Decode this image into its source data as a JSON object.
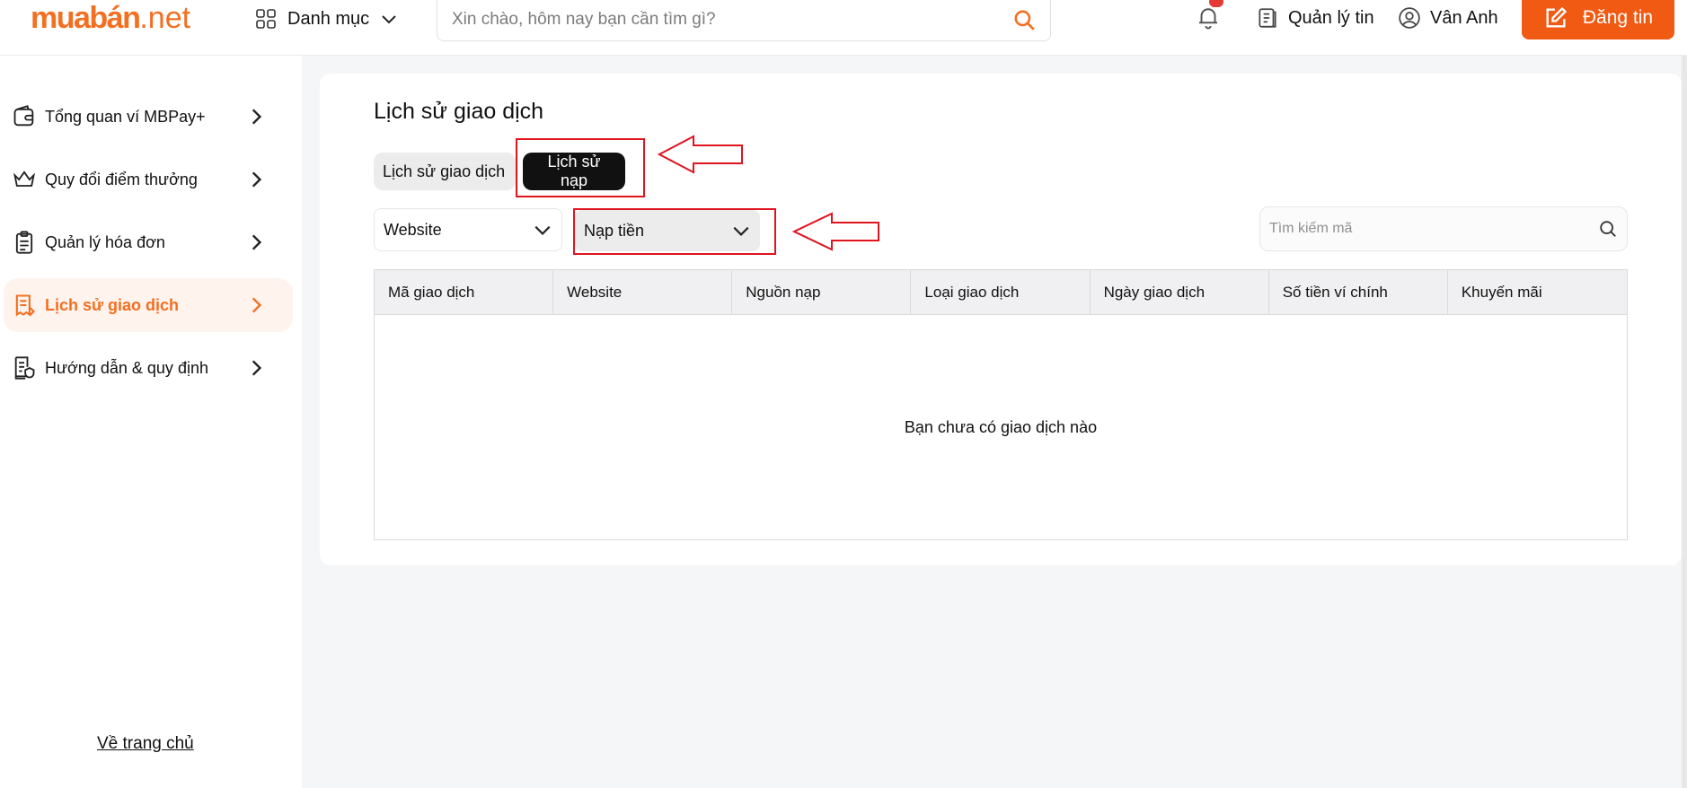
{
  "header": {
    "logo_main": "muabán",
    "logo_domain": ".net",
    "category_label": "Danh mục",
    "search_placeholder": "Xin chào, hôm nay bạn cần tìm gì?",
    "manage_label": "Quản lý tin",
    "user_name": "Vân Anh",
    "post_label": "Đăng tin",
    "accent_color": "#f36f21"
  },
  "sidebar": {
    "items": [
      {
        "label": "Tổng quan ví MBPay+",
        "icon": "wallet-icon"
      },
      {
        "label": "Quy đổi điểm thưởng",
        "icon": "crown-icon"
      },
      {
        "label": "Quản lý hóa đơn",
        "icon": "clipboard-icon"
      },
      {
        "label": "Lịch sử giao dịch",
        "icon": "receipt-icon",
        "active": true
      },
      {
        "label": "Hướng dẫn & quy định",
        "icon": "document-shield-icon"
      }
    ],
    "home_link": "Về trang chủ"
  },
  "main": {
    "title": "Lịch sử giao dịch",
    "tabs": [
      {
        "label": "Lịch sử giao dịch",
        "active": false
      },
      {
        "label": "Lịch sử nạp",
        "active": true
      }
    ],
    "filters": {
      "website": "Website",
      "type": "Nạp tiền"
    },
    "search_placeholder": "Tìm kiếm mã",
    "table": {
      "columns": [
        "Mã giao dịch",
        "Website",
        "Nguồn nạp",
        "Loại giao dịch",
        "Ngày giao dịch",
        "Số tiền ví chính",
        "Khuyến mãi"
      ],
      "empty_message": "Bạn chưa có giao dịch nào"
    },
    "annotation_color": "#e0141e"
  }
}
